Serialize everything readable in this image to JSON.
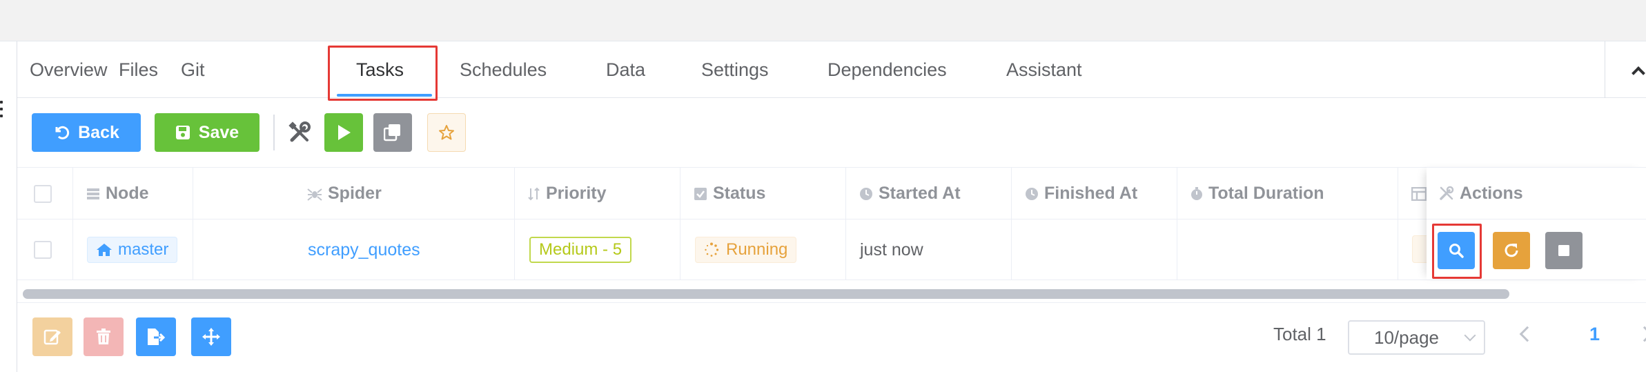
{
  "tabs": [
    {
      "label": "Overview"
    },
    {
      "label": "Files"
    },
    {
      "label": "Git"
    },
    {
      "label": "Tasks",
      "active": true
    },
    {
      "label": "Schedules"
    },
    {
      "label": "Data"
    },
    {
      "label": "Settings"
    },
    {
      "label": "Dependencies"
    },
    {
      "label": "Assistant"
    }
  ],
  "toolbar": {
    "back_label": "Back",
    "save_label": "Save",
    "icons": [
      "tools-icon",
      "run-icon",
      "clone-icon",
      "star-icon"
    ]
  },
  "table": {
    "columns": [
      {
        "label": "Node",
        "icon": "server-icon"
      },
      {
        "label": "Spider",
        "icon": "spider-icon"
      },
      {
        "label": "Priority",
        "icon": "sort-icon"
      },
      {
        "label": "Status",
        "icon": "check-square-icon"
      },
      {
        "label": "Started At",
        "icon": "clock-icon"
      },
      {
        "label": "Finished At",
        "icon": "clock-icon"
      },
      {
        "label": "Total Duration",
        "icon": "stopwatch-icon"
      },
      {
        "label": "Actions",
        "icon": "tools-icon"
      }
    ],
    "rows": [
      {
        "node": "master",
        "spider": "scrapy_quotes",
        "priority": "Medium - 5",
        "status": "Running",
        "started_at": "just now",
        "finished_at": "",
        "total_duration": ""
      }
    ],
    "row_actions": [
      "view-icon",
      "restart-icon",
      "stop-icon"
    ]
  },
  "colors": {
    "primary": "#409eff",
    "success": "#67c23a",
    "warning": "#e6a23c",
    "info": "#909399",
    "highlight": "#e53935"
  },
  "footer": {
    "bulk_actions": [
      "edit-icon",
      "delete-icon",
      "export-icon",
      "move-icon"
    ],
    "total_label": "Total 1",
    "page_size": "10/page",
    "current_page": "1"
  }
}
